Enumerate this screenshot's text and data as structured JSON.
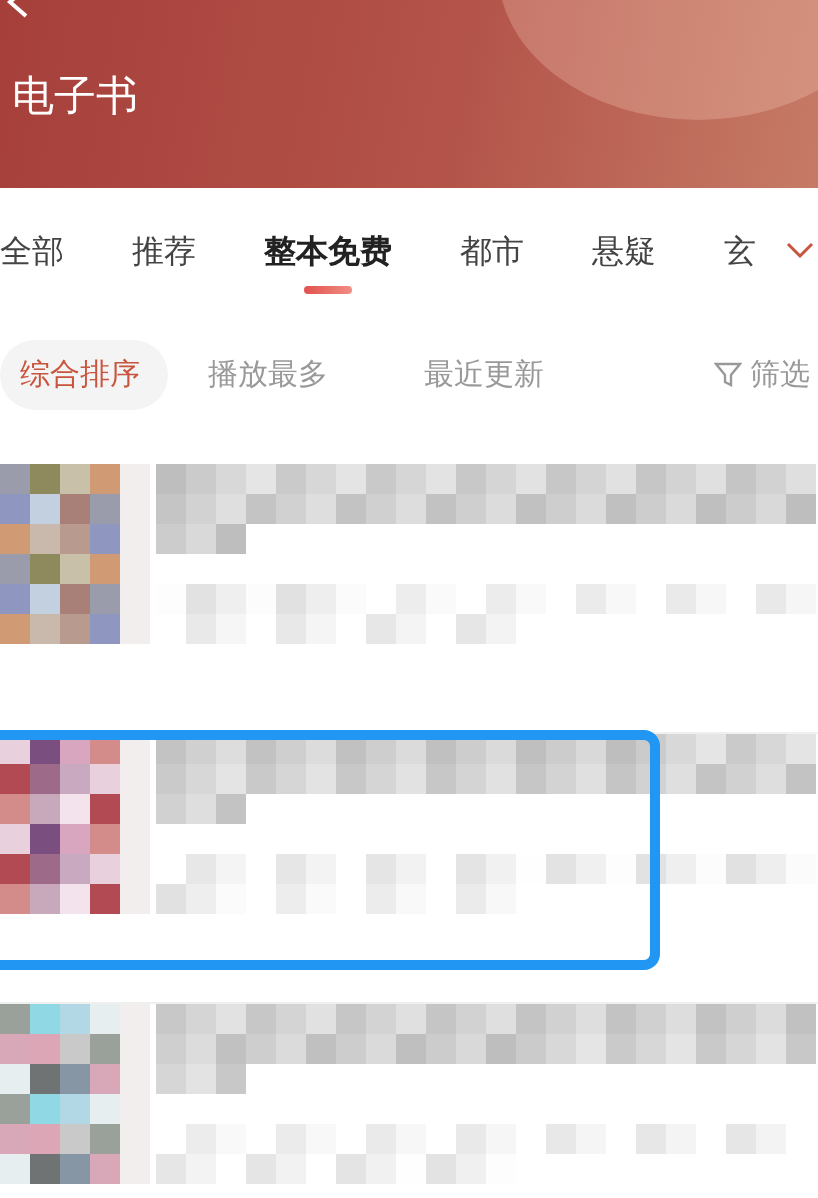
{
  "header": {
    "title": "电子书"
  },
  "tabs": [
    {
      "label": "全部",
      "selected": false
    },
    {
      "label": "推荐",
      "selected": false
    },
    {
      "label": "整本免费",
      "selected": true
    },
    {
      "label": "都市",
      "selected": false
    },
    {
      "label": "悬疑",
      "selected": false
    },
    {
      "label": "玄",
      "selected": false
    }
  ],
  "sort_options": [
    {
      "label": "综合排序",
      "selected": true
    },
    {
      "label": "播放最多",
      "selected": false
    },
    {
      "label": "最近更新",
      "selected": false
    }
  ],
  "filter": {
    "label": "筛选"
  },
  "results": [
    {
      "kind": "picture",
      "highlighted": false
    },
    {
      "kind": "picture",
      "highlighted": true
    },
    {
      "kind": "picture",
      "highlighted": false
    }
  ]
}
